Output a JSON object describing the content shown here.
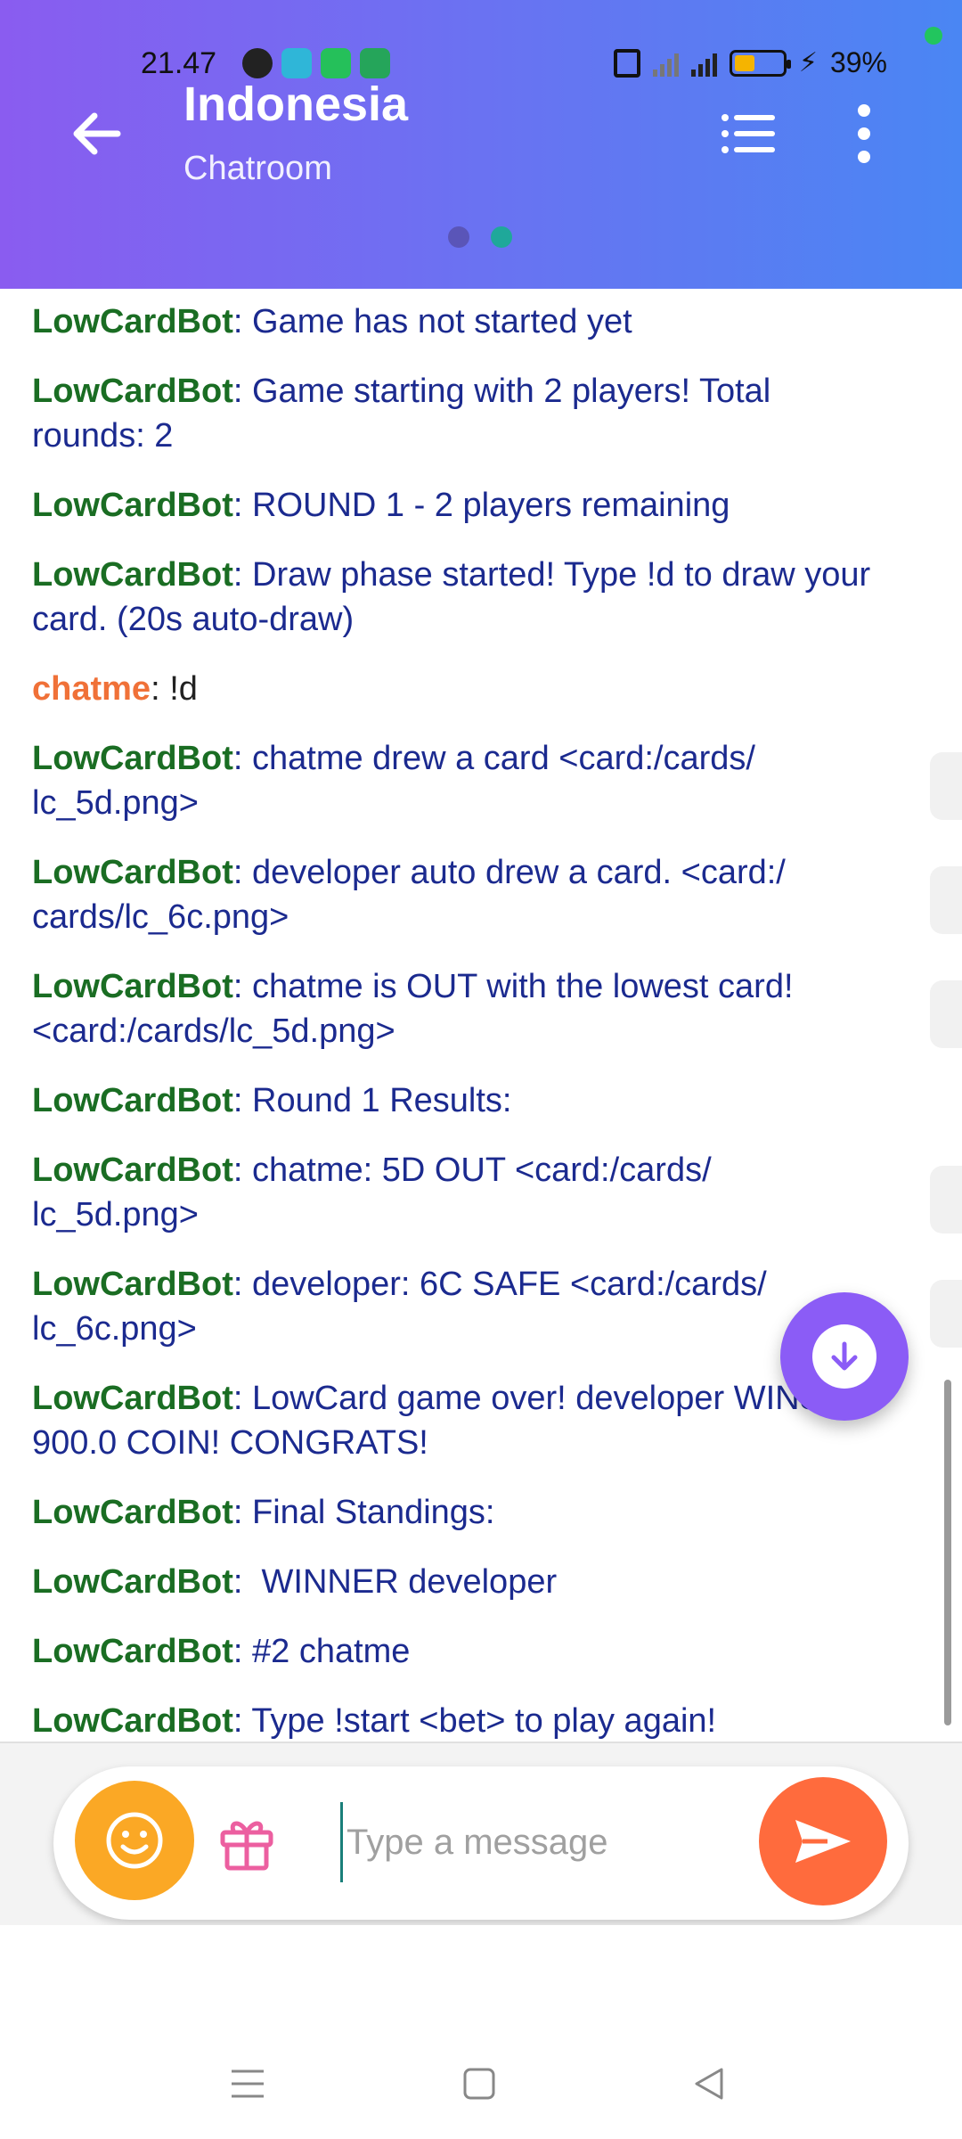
{
  "status_bar": {
    "time": "21.47",
    "battery_text": "39%"
  },
  "header": {
    "title": "Indonesia",
    "subtitle": "Chatroom",
    "colors": {
      "gradient_start": "#8a5cf0",
      "gradient_end": "#4a86f3"
    },
    "page_dots": [
      {
        "color": "#5a55b8",
        "active": false
      },
      {
        "color": "#1fa89a",
        "active": true
      }
    ]
  },
  "messages": [
    {
      "user": "LowCardBot",
      "type": "bot",
      "text": "Game has not started yet"
    },
    {
      "user": "LowCardBot",
      "type": "bot",
      "text": "Game starting with 2 players! Total rounds: 2"
    },
    {
      "user": "LowCardBot",
      "type": "bot",
      "text": "ROUND 1 - 2 players remaining"
    },
    {
      "user": "LowCardBot",
      "type": "bot",
      "text": "Draw phase started! Type !d to draw your card. (20s auto-draw)"
    },
    {
      "user": "chatme",
      "type": "human",
      "text": "!d"
    },
    {
      "user": "LowCardBot",
      "type": "bot",
      "text": "chatme drew a card <card:/cards/ lc_5d.png>"
    },
    {
      "user": "LowCardBot",
      "type": "bot",
      "text": "developer auto drew a card. <card:/ cards/lc_6c.png>"
    },
    {
      "user": "LowCardBot",
      "type": "bot",
      "text": "chatme is OUT with the lowest card! <card:/cards/lc_5d.png>"
    },
    {
      "user": "LowCardBot",
      "type": "bot",
      "text": "Round 1 Results:"
    },
    {
      "user": "LowCardBot",
      "type": "bot",
      "text": "chatme: 5D OUT <card:/cards/ lc_5d.png>"
    },
    {
      "user": "LowCardBot",
      "type": "bot",
      "text": "developer: 6C SAFE <card:/cards/ lc_6c.png>"
    },
    {
      "user": "LowCardBot",
      "type": "bot",
      "text": "LowCard game over! developer WINS 900.0 COIN! CONGRATS!"
    },
    {
      "user": "LowCardBot",
      "type": "bot",
      "text": "Final Standings:"
    },
    {
      "user": "LowCardBot",
      "type": "bot",
      "text": " WINNER developer"
    },
    {
      "user": "LowCardBot",
      "type": "bot",
      "text": "#2 chatme"
    },
    {
      "user": "LowCardBot",
      "type": "bot",
      "text": "Type !start <bet> to play again!"
    }
  ],
  "composer": {
    "placeholder": "Type a message",
    "value": ""
  },
  "icons": {
    "back": "back-arrow-icon",
    "list": "list-icon",
    "more": "more-vertical-icon",
    "scroll_down": "arrow-down-icon",
    "emoji": "emoji-icon",
    "gift": "gift-icon",
    "send": "send-icon"
  },
  "colors": {
    "bot_name": "#1a6d23",
    "human_name": "#f07138",
    "message_text": "#1b2a8f",
    "fab": "#8b5cf6",
    "emoji_button": "#fba825",
    "send_button": "#ff6b3d",
    "gift_icon": "#ec5fa0"
  }
}
